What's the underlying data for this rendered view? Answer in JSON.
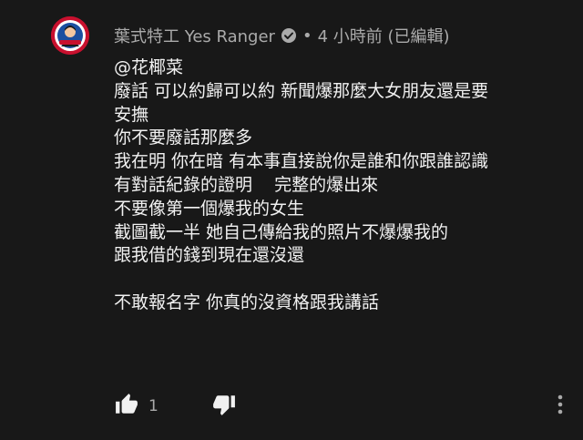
{
  "comment": {
    "author": "葉式特工 Yes Ranger",
    "separator": "•",
    "time": "4 小時前 (已編輯)",
    "lines": [
      "@花椰菜",
      "廢話 可以約歸可以約 新聞爆那麼大女朋友還是要",
      "安撫",
      "你不要廢話那麼多",
      "我在明 你在暗 有本事直接說你是誰和你跟誰認識",
      "有對話紀錄的證明    完整的爆出來",
      "不要像第一個爆我的女生",
      "截圖截一半 她自己傳給我的照片不爆爆我的",
      "跟我借的錢到現在還沒還",
      "",
      "不敢報名字 你真的沒資格跟我講話"
    ],
    "likes": "1"
  },
  "icons": {
    "avatar": "avatar-image",
    "verified": "verified-check-icon",
    "like": "thumbs-up-icon",
    "dislike": "thumbs-down-icon",
    "more": "more-vert-icon"
  },
  "colors": {
    "background": "#181818",
    "text": "#f1f1f1",
    "secondary": "#aaaaaa",
    "avatar_accent": "#c8102e"
  }
}
